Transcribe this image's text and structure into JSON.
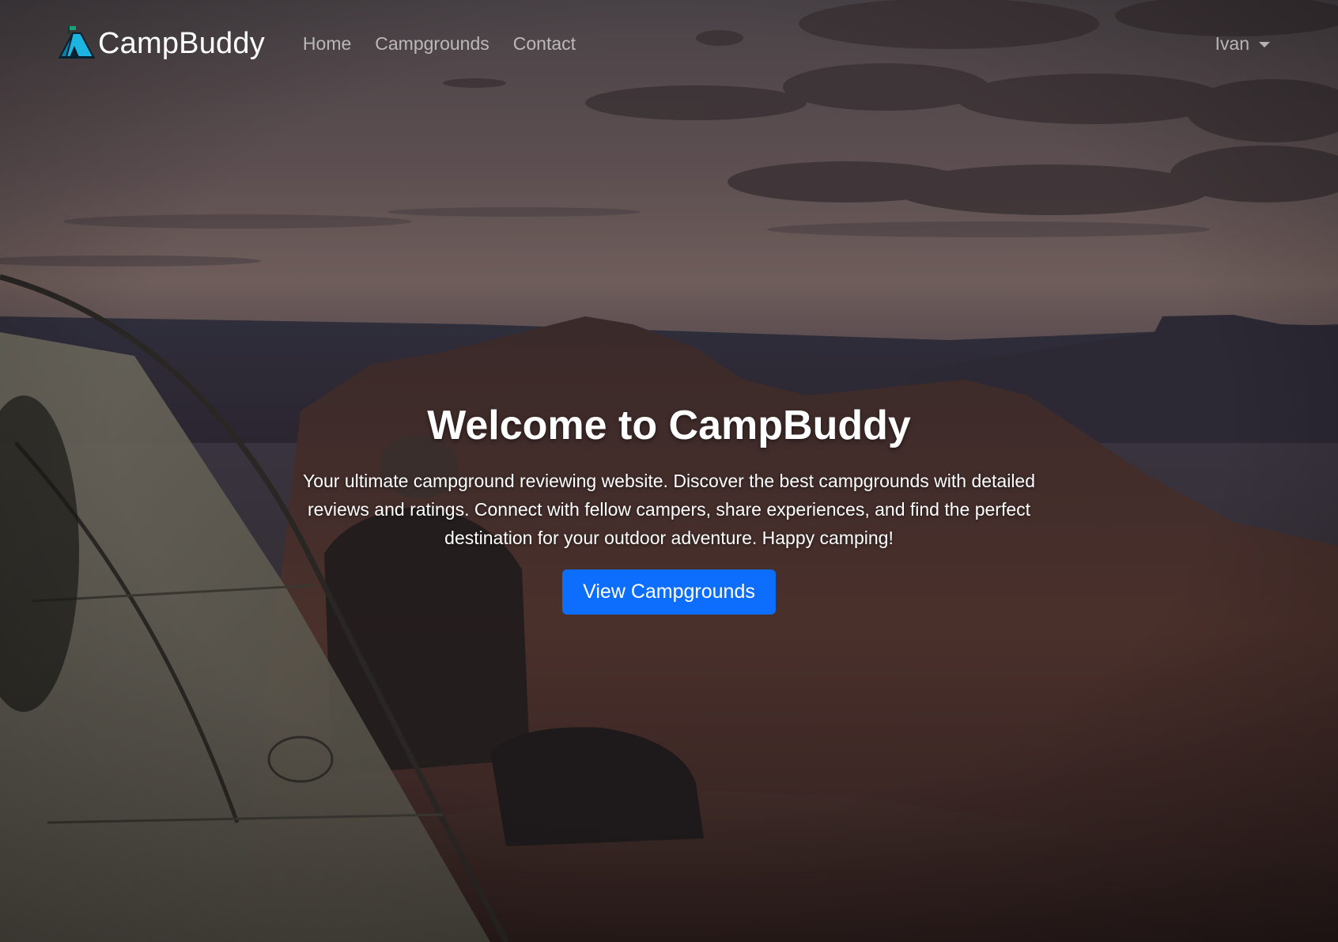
{
  "navbar": {
    "brand_name": "CampBuddy",
    "brand_icon": "tent-logo-icon",
    "links": [
      {
        "label": "Home"
      },
      {
        "label": "Campgrounds"
      },
      {
        "label": "Contact"
      }
    ],
    "user_menu_label": "Ivan",
    "user_menu_icon": "caret-down-icon"
  },
  "hero": {
    "title": "Welcome to CampBuddy",
    "description": "Your ultimate campground reviewing website. Discover the best campgrounds with detailed reviews and ratings. Connect with fellow campers, share experiences, and find the perfect destination for your outdoor adventure. Happy camping!",
    "cta_label": "View Campgrounds"
  },
  "colors": {
    "primary_button": "#0d6efd",
    "text_light": "#ffffff",
    "nav_muted": "rgba(255,255,255,0.62)"
  }
}
